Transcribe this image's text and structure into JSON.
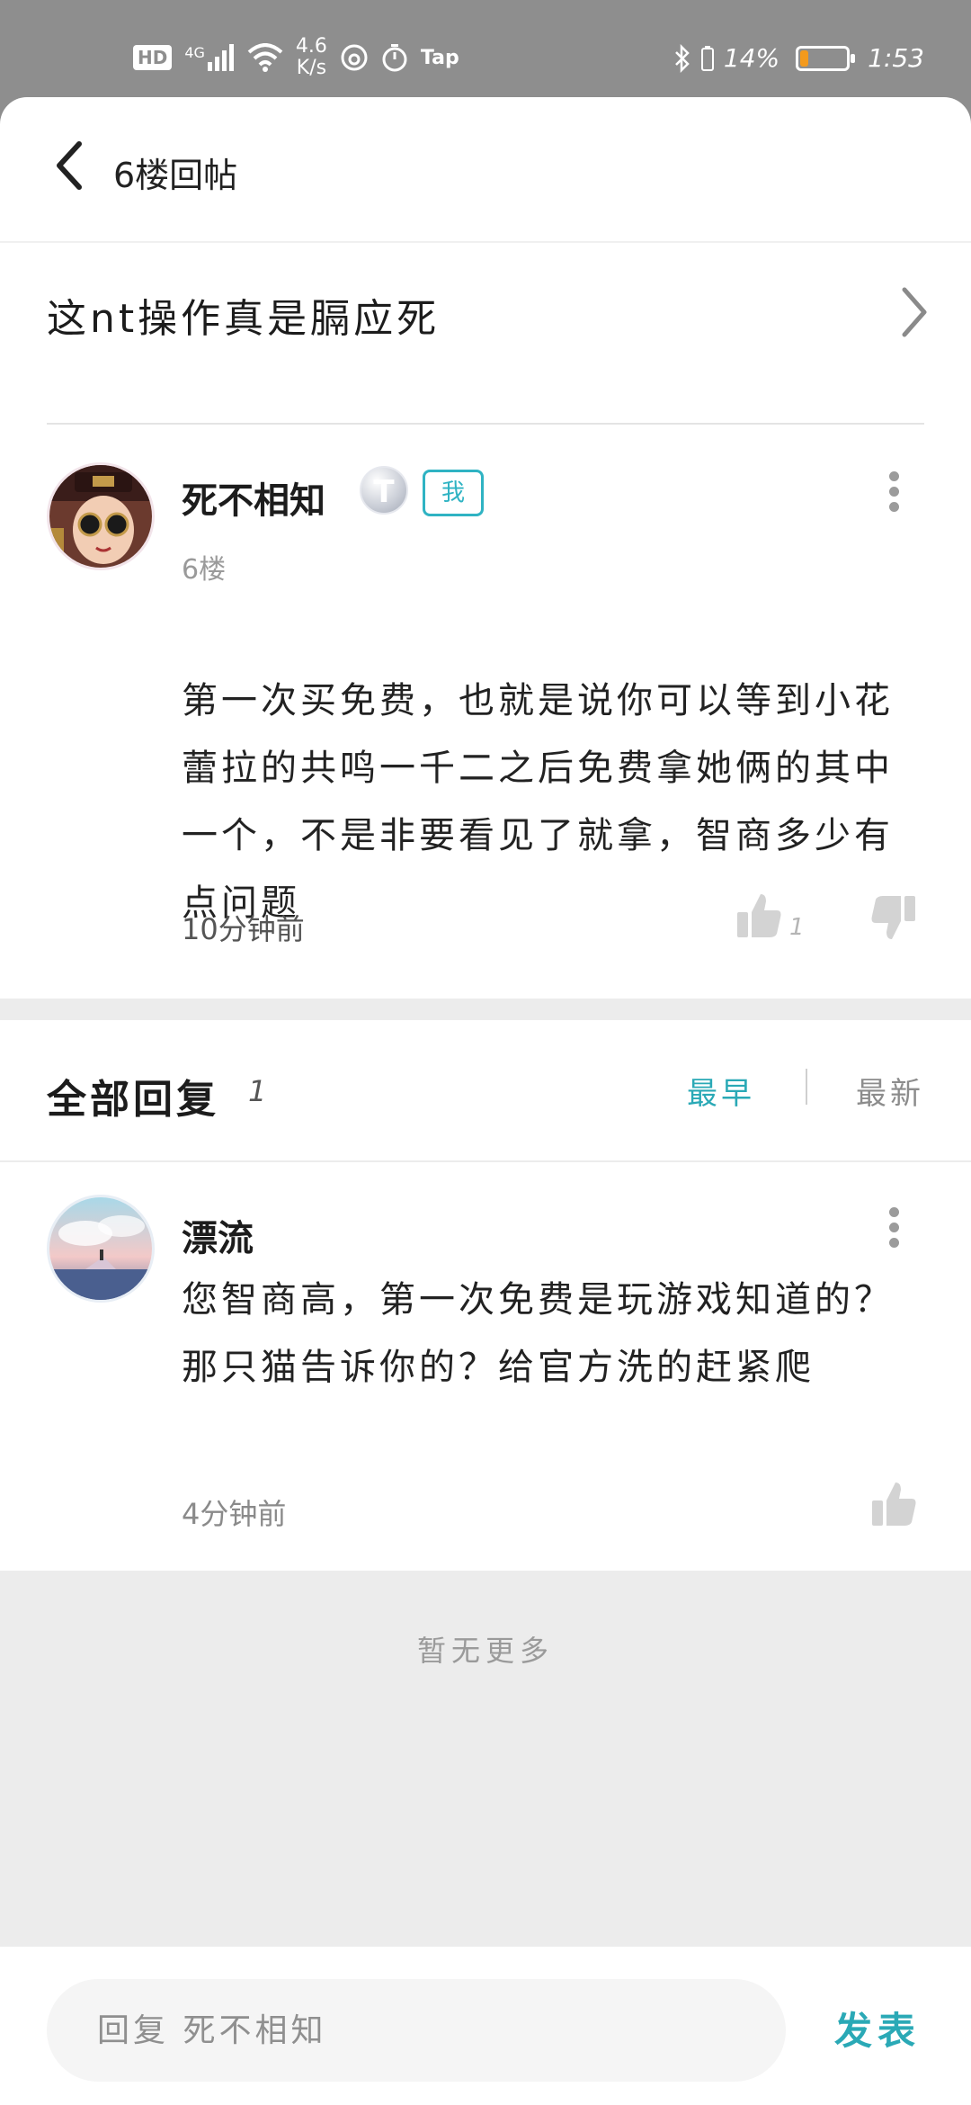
{
  "status_bar": {
    "hd": "HD",
    "network": "4G",
    "speed_value": "4.6",
    "speed_unit": "K/s",
    "tap": "Tap",
    "battery_percent": "14%",
    "time": "1:53",
    "battery_level": 0.14,
    "battery_color": "#f39a1d"
  },
  "header": {
    "title": "6楼回帖"
  },
  "post": {
    "title": "这nt操作真是膈应死"
  },
  "floor_post": {
    "username": "死不相知",
    "badge_letter": "T",
    "me_badge": "我",
    "floor": "6楼",
    "content": "第一次买免费，也就是说你可以等到小花蕾拉的共鸣一千二之后免费拿她俩的其中一个，不是非要看见了就拿，智商多少有点问题",
    "time": "10分钟前",
    "like_count": "1"
  },
  "replies": {
    "title": "全部回复",
    "count": "1",
    "sort_earliest": "最早",
    "sort_latest": "最新",
    "items": [
      {
        "username": "漂流",
        "content": "您智商高，第一次免费是玩游戏知道的？那只猫告诉你的？给官方洗的赶紧爬",
        "time": "4分钟前"
      }
    ],
    "no_more": "暂无更多"
  },
  "bottom": {
    "reply_placeholder": "回复 死不相知",
    "send_label": "发表"
  },
  "colors": {
    "accent": "#2aa9b6",
    "status_bar_bg": "#8e8e8e"
  }
}
